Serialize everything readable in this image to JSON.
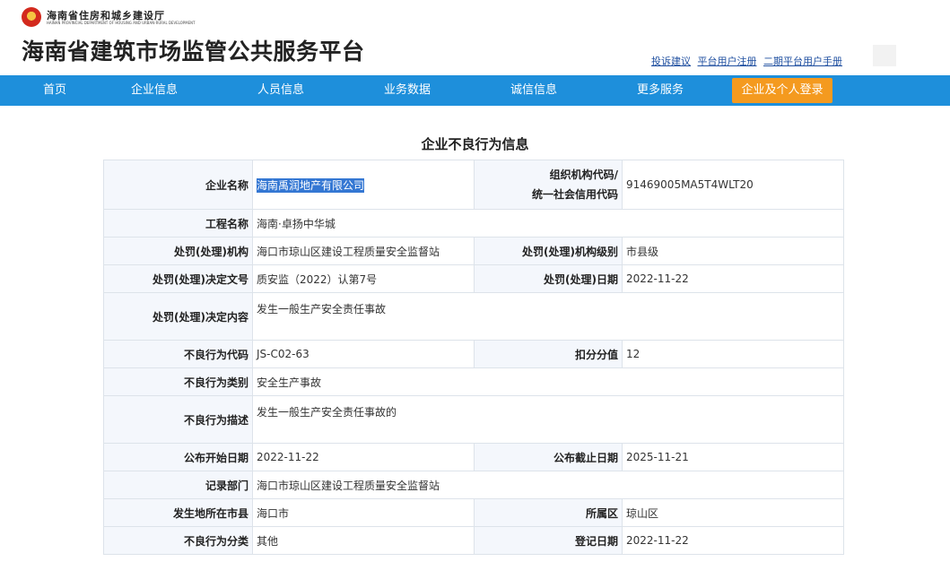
{
  "header": {
    "dept_cn": "海南省住房和城乡建设厅",
    "dept_en": "HAINAN PROVINCIAL DEPARTMENT OF HOUSING AND URBAN-RURAL DEVELOPMENT",
    "site_title": "海南省建筑市场监管公共服务平台",
    "links": [
      "投诉建议",
      "平台用户注册",
      "二期平台用户手册"
    ]
  },
  "nav": {
    "items": [
      "首页",
      "企业信息",
      "人员信息",
      "业务数据",
      "诚信信息",
      "更多服务"
    ],
    "login_label": "企业及个人登录",
    "bar_color": "#1e8fdb",
    "login_color": "#f49a1f"
  },
  "page": {
    "heading": "企业不良行为信息"
  },
  "record": {
    "company_name_label": "企业名称",
    "company_name": "海南禹润地产有限公司",
    "org_code_label_1": "组织机构代码/",
    "org_code_label_2": "统一社会信用代码",
    "org_code": "91469005MA5T4WLT20",
    "project_name_label": "工程名称",
    "project_name": "海南·卓扬中华城",
    "penalty_org_label": "处罚(处理)机构",
    "penalty_org": "海口市琼山区建设工程质量安全监督站",
    "penalty_org_level_label": "处罚(处理)机构级别",
    "penalty_org_level": "市县级",
    "decision_no_label": "处罚(处理)决定文号",
    "decision_no": "质安监（2022）认第7号",
    "decision_date_label": "处罚(处理)日期",
    "decision_date": "2022-11-22",
    "decision_content_label": "处罚(处理)决定内容",
    "decision_content": "发生一般生产安全责任事故",
    "behavior_code_label": "不良行为代码",
    "behavior_code": "JS-C02-63",
    "deduction_label": "扣分分值",
    "deduction": "12",
    "behavior_type_label": "不良行为类别",
    "behavior_type": "安全生产事故",
    "behavior_desc_label": "不良行为描述",
    "behavior_desc": "发生一般生产安全责任事故的",
    "publish_start_label": "公布开始日期",
    "publish_start": "2022-11-22",
    "publish_end_label": "公布截止日期",
    "publish_end": "2025-11-21",
    "record_dept_label": "记录部门",
    "record_dept": "海口市琼山区建设工程质量安全监督站",
    "city_label": "发生地所在市县",
    "city": "海口市",
    "district_label": "所属区",
    "district": "琼山区",
    "category_label": "不良行为分类",
    "category": "其他",
    "register_date_label": "登记日期",
    "register_date": "2022-11-22"
  }
}
